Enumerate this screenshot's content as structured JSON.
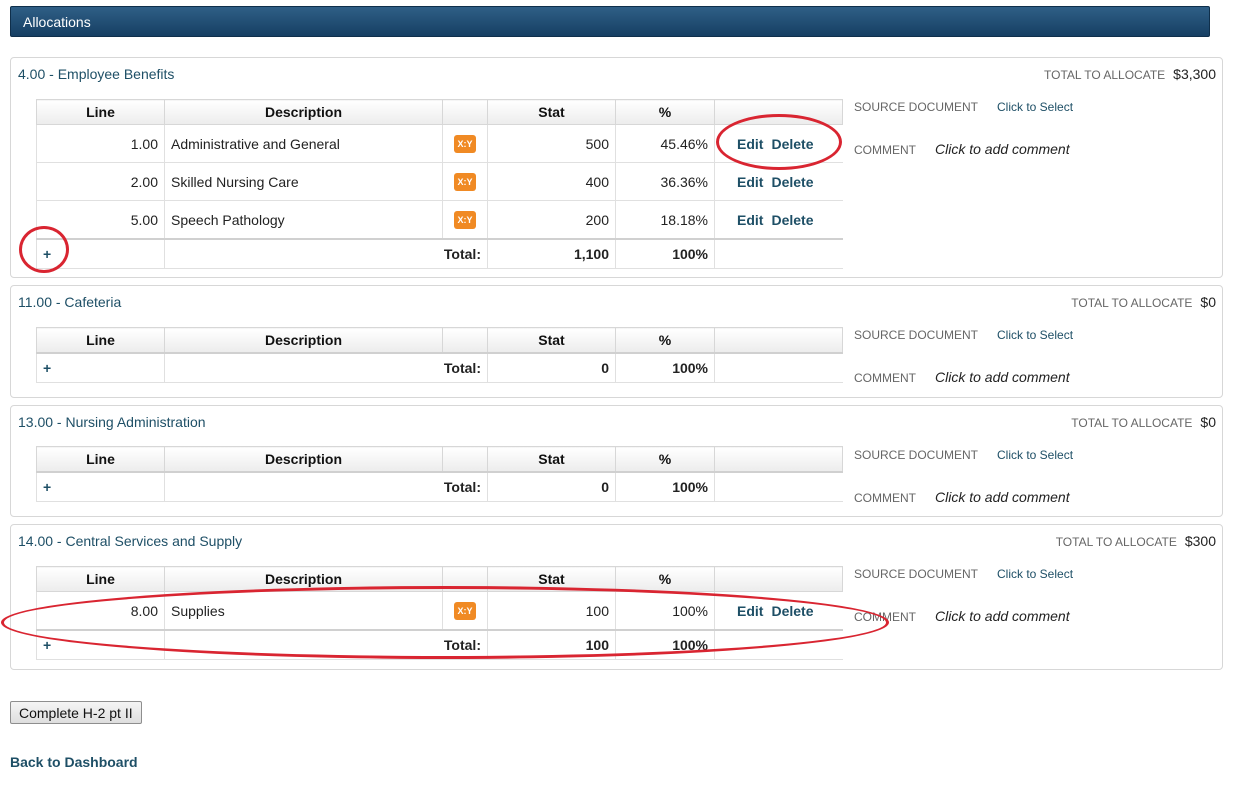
{
  "header": {
    "title": "Allocations"
  },
  "columns": {
    "line": "Line",
    "description": "Description",
    "stat": "Stat",
    "percent": "%"
  },
  "labels": {
    "total_to_allocate": "TOTAL TO ALLOCATE",
    "source_document": "SOURCE DOCUMENT",
    "click_to_select": "Click to Select",
    "comment": "COMMENT",
    "click_to_add_comment": "Click to add comment",
    "edit": "Edit",
    "delete": "Delete",
    "add": "+",
    "total": "Total:",
    "xy_icon_text": "X:Y"
  },
  "sections": [
    {
      "title": "4.00 - Employee Benefits",
      "total_to_allocate": "$3,300",
      "rows": [
        {
          "line": "1.00",
          "description": "Administrative and General",
          "stat": "500",
          "percent": "45.46%"
        },
        {
          "line": "2.00",
          "description": "Skilled Nursing Care",
          "stat": "400",
          "percent": "36.36%"
        },
        {
          "line": "5.00",
          "description": "Speech Pathology",
          "stat": "200",
          "percent": "18.18%"
        }
      ],
      "total_stat": "1,100",
      "total_percent": "100%"
    },
    {
      "title": "11.00 - Cafeteria",
      "total_to_allocate": "$0",
      "rows": [],
      "total_stat": "0",
      "total_percent": "100%"
    },
    {
      "title": "13.00 - Nursing Administration",
      "total_to_allocate": "$0",
      "rows": [],
      "total_stat": "0",
      "total_percent": "100%"
    },
    {
      "title": "14.00 - Central Services and Supply",
      "total_to_allocate": "$300",
      "rows": [
        {
          "line": "8.00",
          "description": "Supplies",
          "stat": "100",
          "percent": "100%"
        }
      ],
      "total_stat": "100",
      "total_percent": "100%"
    }
  ],
  "footer": {
    "complete_button": "Complete H-2 pt II",
    "back_link": "Back to Dashboard"
  },
  "colors": {
    "header": "#1f4a6f",
    "link": "#1e4f66",
    "xy_icon": "#f08a24",
    "annotation": "#d92531"
  }
}
